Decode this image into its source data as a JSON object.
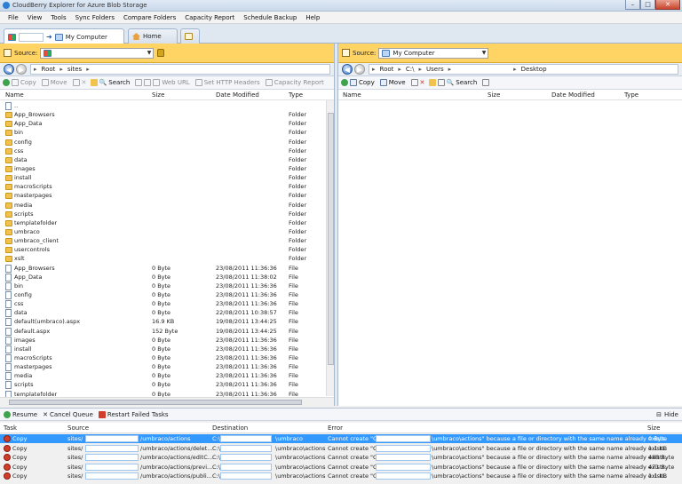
{
  "window": {
    "title": "CloudBerry Explorer for Azure Blob Storage"
  },
  "menu": [
    "File",
    "View",
    "Tools",
    "Sync Folders",
    "Compare Folders",
    "Capacity Report",
    "Schedule Backup",
    "Help"
  ],
  "tabs": {
    "computer": "My Computer",
    "home": "Home"
  },
  "left": {
    "source_label": "Source:",
    "source_value": "",
    "crumbs": [
      "Root",
      "sites"
    ],
    "toolbar": [
      "Copy",
      "Move",
      "Search",
      "Web URL",
      "Set HTTP Headers",
      "Capacity Report"
    ],
    "headers": {
      "name": "Name",
      "size": "Size",
      "date": "Date Modified",
      "type": "Type"
    },
    "rows": [
      {
        "name": "..",
        "size": "",
        "date": "",
        "type": "",
        "kind": "up"
      },
      {
        "name": "App_Browsers",
        "size": "",
        "date": "",
        "type": "Folder",
        "kind": "folder"
      },
      {
        "name": "App_Data",
        "size": "",
        "date": "",
        "type": "Folder",
        "kind": "folder"
      },
      {
        "name": "bin",
        "size": "",
        "date": "",
        "type": "Folder",
        "kind": "folder"
      },
      {
        "name": "config",
        "size": "",
        "date": "",
        "type": "Folder",
        "kind": "folder"
      },
      {
        "name": "css",
        "size": "",
        "date": "",
        "type": "Folder",
        "kind": "folder"
      },
      {
        "name": "data",
        "size": "",
        "date": "",
        "type": "Folder",
        "kind": "folder"
      },
      {
        "name": "images",
        "size": "",
        "date": "",
        "type": "Folder",
        "kind": "folder"
      },
      {
        "name": "install",
        "size": "",
        "date": "",
        "type": "Folder",
        "kind": "folder"
      },
      {
        "name": "macroScripts",
        "size": "",
        "date": "",
        "type": "Folder",
        "kind": "folder"
      },
      {
        "name": "masterpages",
        "size": "",
        "date": "",
        "type": "Folder",
        "kind": "folder"
      },
      {
        "name": "media",
        "size": "",
        "date": "",
        "type": "Folder",
        "kind": "folder"
      },
      {
        "name": "scripts",
        "size": "",
        "date": "",
        "type": "Folder",
        "kind": "folder"
      },
      {
        "name": "templatefolder",
        "size": "",
        "date": "",
        "type": "Folder",
        "kind": "folder"
      },
      {
        "name": "umbraco",
        "size": "",
        "date": "",
        "type": "Folder",
        "kind": "folder"
      },
      {
        "name": "umbraco_client",
        "size": "",
        "date": "",
        "type": "Folder",
        "kind": "folder"
      },
      {
        "name": "usercontrols",
        "size": "",
        "date": "",
        "type": "Folder",
        "kind": "folder"
      },
      {
        "name": "xslt",
        "size": "",
        "date": "",
        "type": "Folder",
        "kind": "folder"
      },
      {
        "name": "App_Browsers",
        "size": "0 Byte",
        "date": "23/08/2011 11:36:36",
        "type": "File",
        "kind": "file"
      },
      {
        "name": "App_Data",
        "size": "0 Byte",
        "date": "23/08/2011 11:38:02",
        "type": "File",
        "kind": "file"
      },
      {
        "name": "bin",
        "size": "0 Byte",
        "date": "23/08/2011 11:36:36",
        "type": "File",
        "kind": "file"
      },
      {
        "name": "config",
        "size": "0 Byte",
        "date": "23/08/2011 11:36:36",
        "type": "File",
        "kind": "file"
      },
      {
        "name": "css",
        "size": "0 Byte",
        "date": "23/08/2011 11:36:36",
        "type": "File",
        "kind": "file"
      },
      {
        "name": "data",
        "size": "0 Byte",
        "date": "22/08/2011 10:38:57",
        "type": "File",
        "kind": "file"
      },
      {
        "name": "default(umbraco).aspx",
        "size": "16.9 KB",
        "date": "19/08/2011 13:44:25",
        "type": "File",
        "kind": "file"
      },
      {
        "name": "default.aspx",
        "size": "152 Byte",
        "date": "19/08/2011 13:44:25",
        "type": "File",
        "kind": "file"
      },
      {
        "name": "images",
        "size": "0 Byte",
        "date": "23/08/2011 11:36:36",
        "type": "File",
        "kind": "file"
      },
      {
        "name": "install",
        "size": "0 Byte",
        "date": "23/08/2011 11:36:36",
        "type": "File",
        "kind": "file"
      },
      {
        "name": "macroScripts",
        "size": "0 Byte",
        "date": "23/08/2011 11:36:36",
        "type": "File",
        "kind": "file"
      },
      {
        "name": "masterpages",
        "size": "0 Byte",
        "date": "23/08/2011 11:36:36",
        "type": "File",
        "kind": "file"
      },
      {
        "name": "media",
        "size": "0 Byte",
        "date": "23/08/2011 11:36:36",
        "type": "File",
        "kind": "file"
      },
      {
        "name": "scripts",
        "size": "0 Byte",
        "date": "23/08/2011 11:36:36",
        "type": "File",
        "kind": "file"
      },
      {
        "name": "templatefolder",
        "size": "0 Byte",
        "date": "23/08/2011 11:36:36",
        "type": "File",
        "kind": "file"
      }
    ]
  },
  "right": {
    "source_label": "Source:",
    "source_value": "My Computer",
    "crumbs": [
      "Root",
      "C:\\",
      "Users",
      "Desktop"
    ],
    "toolbar": [
      "Copy",
      "Move",
      "Search"
    ],
    "headers": {
      "name": "Name",
      "size": "Size",
      "date": "Date Modified",
      "type": "Type"
    }
  },
  "queue": {
    "buttons": [
      "Resume",
      "Cancel Queue",
      "Restart Failed Tasks"
    ],
    "hide": "Hide",
    "headers": {
      "task": "Task",
      "source": "Source",
      "destination": "Destination",
      "error": "Error",
      "size": "Size"
    },
    "rows": [
      {
        "task": "Copy",
        "src_a": "sites/",
        "src_b": "/umbraco/actions",
        "dst_a": "C:\\",
        "dst_b": "\\umbraco",
        "err_a": "Cannot create \"C:\\",
        "err_b": "\\umbraco\\actions\" because a file or directory with the same name already exists.",
        "size": "0 Byte"
      },
      {
        "task": "Copy",
        "src_a": "sites/",
        "src_b": "/umbraco/actions/delet...",
        "dst_a": "C:\\",
        "dst_b": "\\umbraco\\actions",
        "err_a": "Cannot create \"C:\\",
        "err_b": "\\umbraco\\actions\" because a file or directory with the same name already exists.",
        "size": "1.1 KB"
      },
      {
        "task": "Copy",
        "src_a": "sites/",
        "src_b": "/umbraco/actions/editC...",
        "dst_a": "C:\\",
        "dst_b": "\\umbraco\\actions",
        "err_a": "Cannot create \"C:\\",
        "err_b": "\\umbraco\\actions\" because a file or directory with the same name already exists.",
        "size": "480 Byte"
      },
      {
        "task": "Copy",
        "src_a": "sites/",
        "src_b": "/umbraco/actions/previ...",
        "dst_a": "C:\\",
        "dst_b": "\\umbraco\\actions",
        "err_a": "Cannot create \"C:\\",
        "err_b": "\\umbraco\\actions\" because a file or directory with the same name already exists.",
        "size": "471 Byte"
      },
      {
        "task": "Copy",
        "src_a": "sites/",
        "src_b": "/umbraco/actions/publi...",
        "dst_a": "C:\\",
        "dst_b": "\\umbraco\\actions",
        "err_a": "Cannot create \"C:\\",
        "err_b": "\\umbraco\\actions\" because a file or directory with the same name already exists.",
        "size": "1.1 KB"
      }
    ]
  }
}
